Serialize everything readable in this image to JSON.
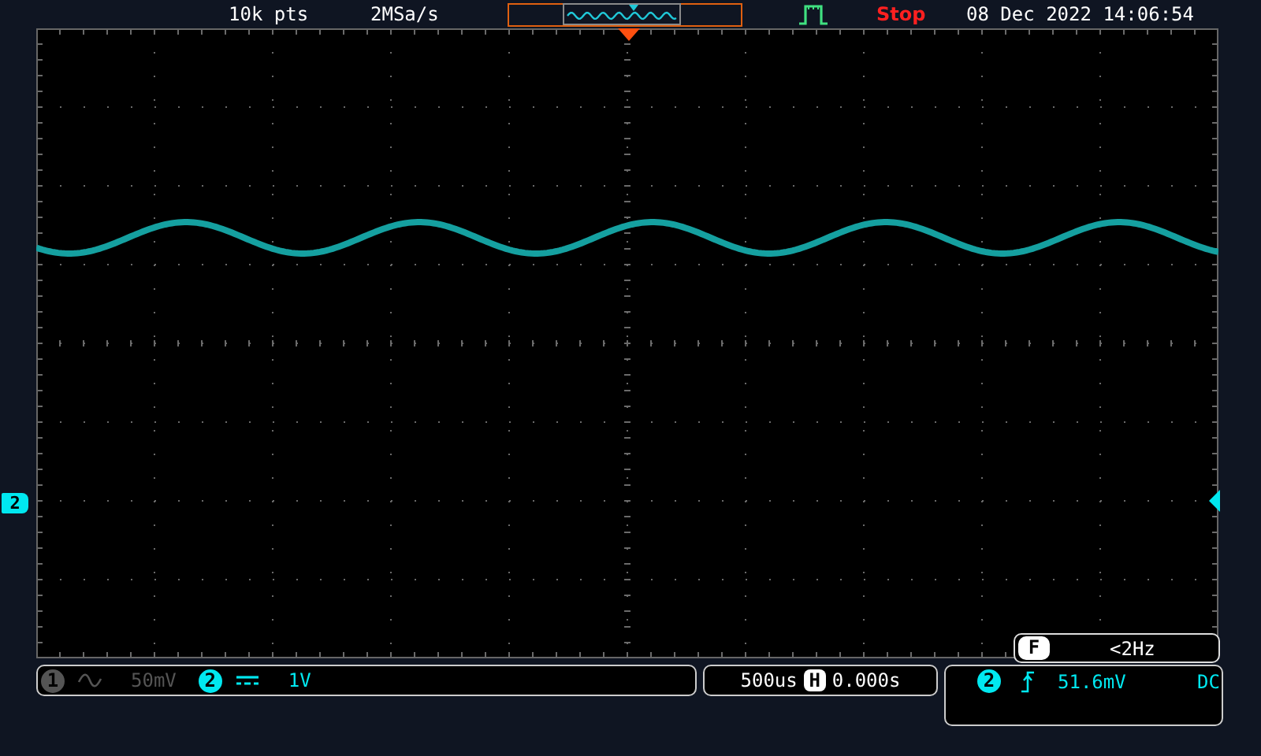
{
  "top_bar": {
    "memory_depth": "10k pts",
    "sample_rate": "2MSa/s",
    "run_state": "Stop",
    "datetime": "08 Dec 2022 14:06:54"
  },
  "display": {
    "channel_marker": "2"
  },
  "frequency": {
    "label": "F",
    "value": "<2Hz"
  },
  "channels": [
    {
      "number": "1",
      "on": false,
      "kind": "ac",
      "scale": "50mV"
    },
    {
      "number": "2",
      "on": true,
      "kind": "dc",
      "scale": "1V"
    }
  ],
  "timebase": {
    "scale": "500us",
    "label": "H",
    "position": "0.000s"
  },
  "trigger": {
    "source": "2",
    "kind": "rising",
    "level": "51.6mV",
    "coupling": "DC"
  }
}
